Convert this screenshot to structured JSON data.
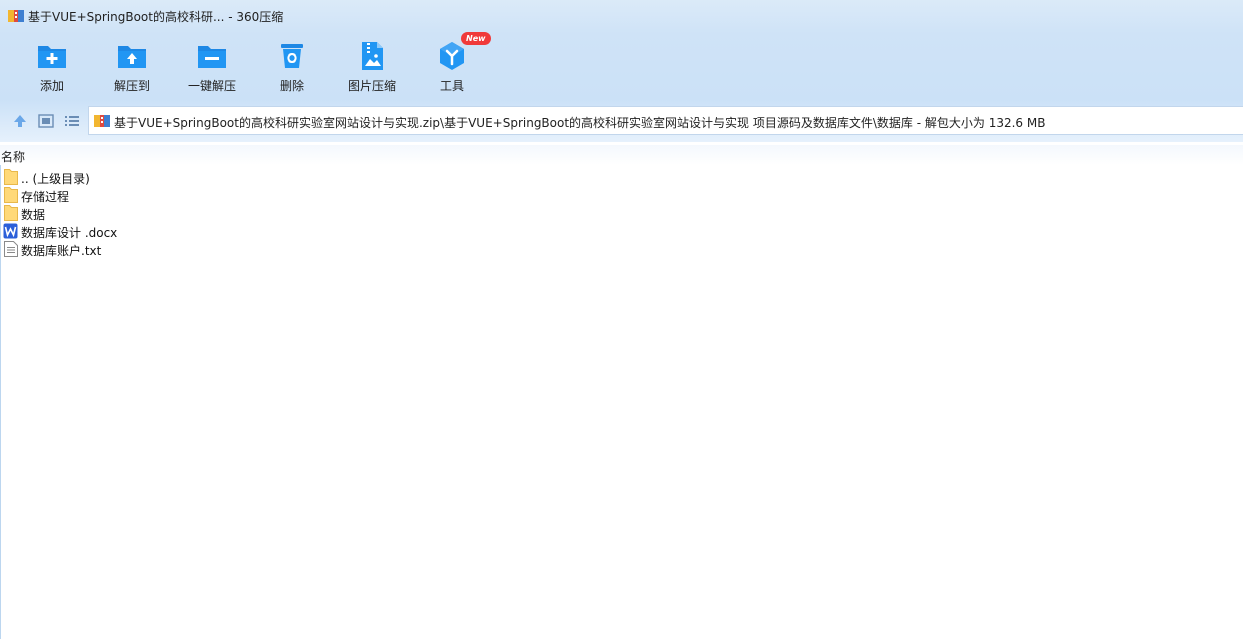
{
  "window": {
    "title": "基于VUE+SpringBoot的高校科研... - 360压缩"
  },
  "toolbar": {
    "items": [
      {
        "label": "添加",
        "icon": "add-icon"
      },
      {
        "label": "解压到",
        "icon": "extract-to-icon"
      },
      {
        "label": "一键解压",
        "icon": "one-click-extract-icon"
      },
      {
        "label": "删除",
        "icon": "delete-icon"
      },
      {
        "label": "图片压缩",
        "icon": "image-compress-icon"
      },
      {
        "label": "工具",
        "icon": "tools-icon",
        "badge": "New"
      }
    ]
  },
  "address": {
    "path": "基于VUE+SpringBoot的高校科研实验室网站设计与实现.zip\\基于VUE+SpringBoot的高校科研实验室网站设计与实现 项目源码及数据库文件\\数据库 - 解包大小为 132.6 MB"
  },
  "list": {
    "column_name": "名称",
    "rows": [
      {
        "name": ".. (上级目录)",
        "type": "folder"
      },
      {
        "name": "存储过程",
        "type": "folder"
      },
      {
        "name": "数据",
        "type": "folder"
      },
      {
        "name": "数据库设计 .docx",
        "type": "word"
      },
      {
        "name": "数据库账户.txt",
        "type": "text"
      }
    ]
  },
  "colors": {
    "accent": "#1e88e5",
    "toolbar_bg": "#cfe3f7",
    "folder": "#ffd978",
    "badge": "#f03a3a"
  }
}
